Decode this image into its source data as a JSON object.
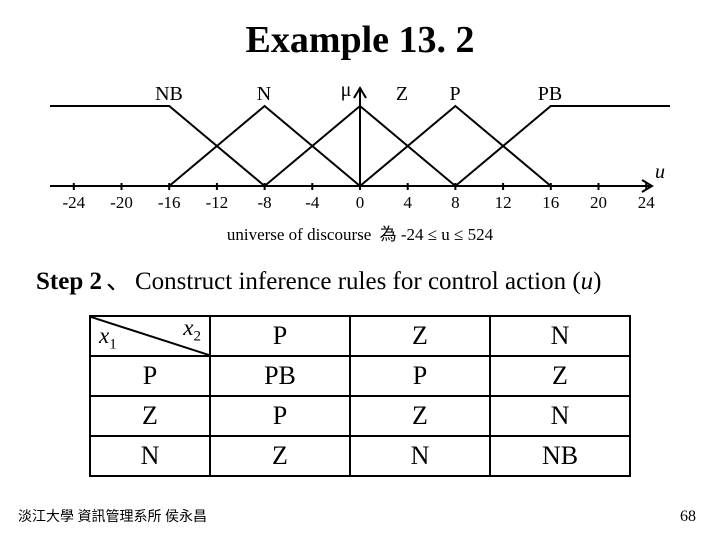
{
  "title": "Example 13. 2",
  "diagram": {
    "labels": [
      "NB",
      "N",
      "Z",
      "P",
      "PB"
    ],
    "mu": "μ",
    "ticks": [
      -24,
      -20,
      -16,
      -12,
      -8,
      -4,
      0,
      4,
      8,
      12,
      16,
      20,
      24
    ],
    "axis_var": "u",
    "caption_prefix": "universe of discourse",
    "caption_cjk": "為",
    "caption_math": "-24 ≤ u ≤ 524"
  },
  "step": {
    "label": "Step 2",
    "sep": "、",
    "text": "Construct inference rules for control action (",
    "var": "u",
    "close": ")"
  },
  "table": {
    "x1": "x",
    "x1sub": "1",
    "x2": "x",
    "x2sub": "2",
    "col_headers": [
      "P",
      "Z",
      "N"
    ],
    "row_headers": [
      "P",
      "Z",
      "N"
    ],
    "cells": [
      [
        "PB",
        "P",
        "Z"
      ],
      [
        "P",
        "Z",
        "N"
      ],
      [
        "Z",
        "N",
        "NB"
      ]
    ]
  },
  "footer": "淡江大學  資訊管理系所  侯永昌",
  "page": "68"
}
